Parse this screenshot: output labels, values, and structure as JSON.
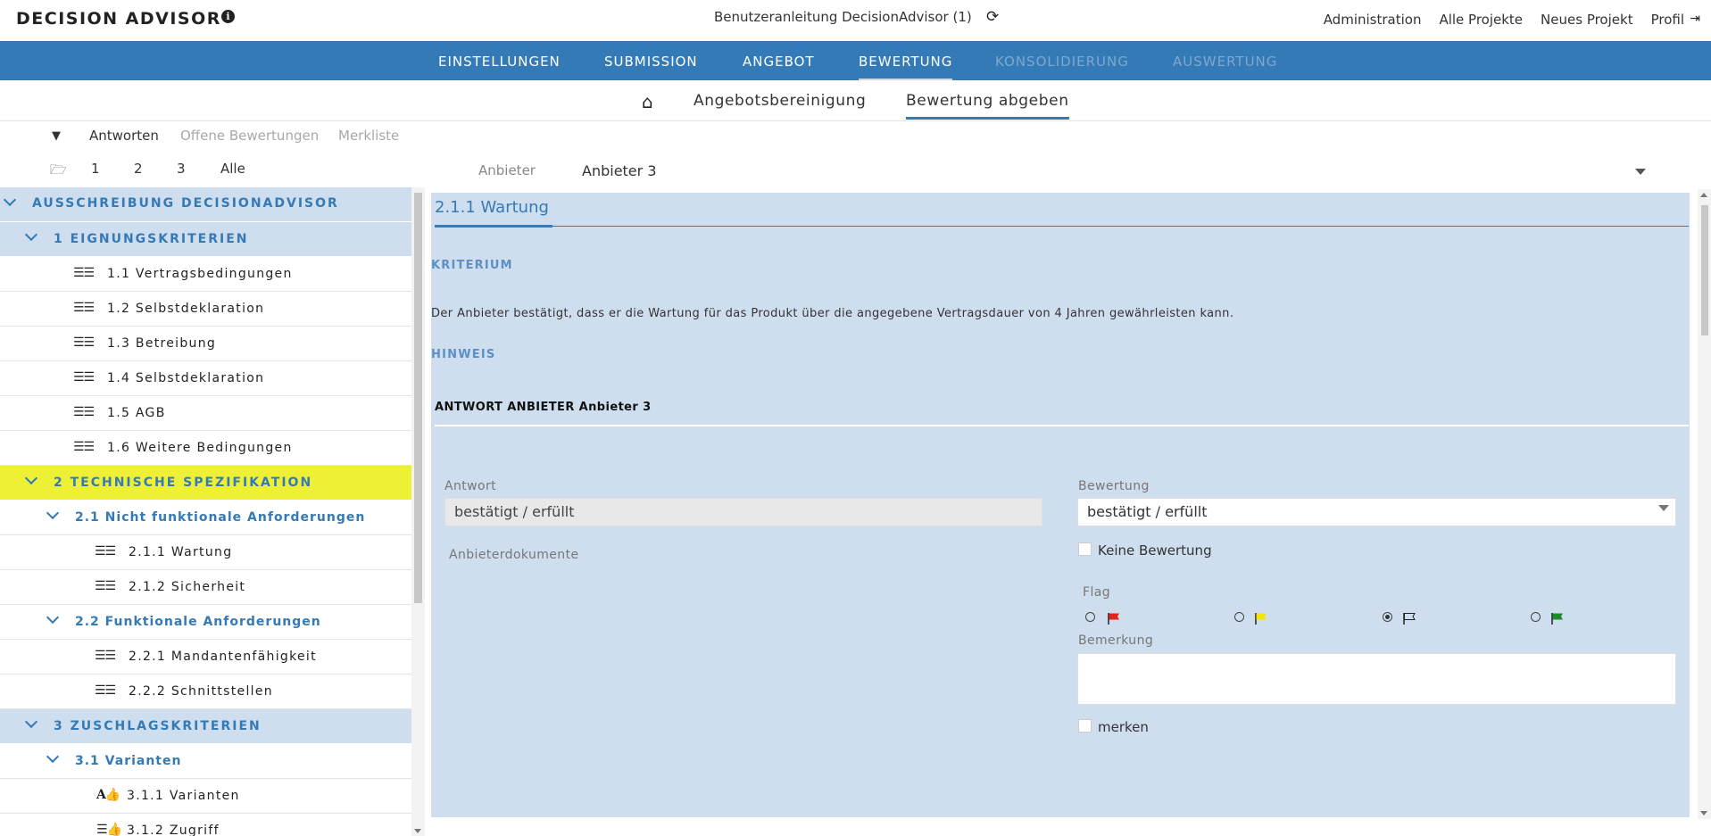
{
  "header": {
    "brand": "DECISION ADVISOR",
    "doc_title": "Benutzeranleitung DecisionAdvisor (1)",
    "nav": [
      "Administration",
      "Alle Projekte",
      "Neues Projekt",
      "Profil"
    ]
  },
  "main_nav": {
    "tabs": [
      {
        "label": "EINSTELLUNGEN",
        "state": "enabled"
      },
      {
        "label": "SUBMISSION",
        "state": "enabled"
      },
      {
        "label": "ANGEBOT",
        "state": "enabled"
      },
      {
        "label": "BEWERTUNG",
        "state": "active"
      },
      {
        "label": "KONSOLIDIERUNG",
        "state": "disabled"
      },
      {
        "label": "AUSWERTUNG",
        "state": "disabled"
      }
    ]
  },
  "sub_nav": {
    "tabs": [
      {
        "label": "Angebotsbereinigung",
        "active": false
      },
      {
        "label": "Bewertung abgeben",
        "active": true
      }
    ]
  },
  "filters": {
    "views": [
      "Antworten",
      "Offene Bewertungen",
      "Merkliste"
    ],
    "active_view": "Antworten",
    "levels": [
      "1",
      "2",
      "3",
      "Alle"
    ]
  },
  "anbieter": {
    "label": "Anbieter",
    "value": "Anbieter 3"
  },
  "tree": [
    {
      "label": "AUSSCHREIBUNG DECISIONADVISOR",
      "kind": "root"
    },
    {
      "label": "1 EIGNUNGSKRITERIEN",
      "kind": "group"
    },
    {
      "label": "1.1 Vertragsbedingungen",
      "kind": "leaf"
    },
    {
      "label": "1.2 Selbstdeklaration",
      "kind": "leaf"
    },
    {
      "label": "1.3 Betreibung",
      "kind": "leaf"
    },
    {
      "label": "1.4 Selbstdeklaration",
      "kind": "leaf"
    },
    {
      "label": "1.5 AGB",
      "kind": "leaf"
    },
    {
      "label": "1.6 Weitere Bedingungen",
      "kind": "leaf"
    },
    {
      "label": "2 TECHNISCHE SPEZIFIKATION",
      "kind": "highlight"
    },
    {
      "label": "2.1 Nicht funktionale Anforderungen",
      "kind": "sub"
    },
    {
      "label": "2.1.1 Wartung",
      "kind": "leaf2"
    },
    {
      "label": "2.1.2 Sicherheit",
      "kind": "leaf2"
    },
    {
      "label": "2.2 Funktionale Anforderungen",
      "kind": "sub"
    },
    {
      "label": "2.2.1 Mandantenfähigkeit",
      "kind": "leaf2"
    },
    {
      "label": "2.2.2 Schnittstellen",
      "kind": "leaf2"
    },
    {
      "label": "3 ZUSCHLAGSKRITERIEN",
      "kind": "group"
    },
    {
      "label": "3.1 Varianten",
      "kind": "sub"
    },
    {
      "label": "3.1.1 Varianten",
      "kind": "leaf2-a"
    },
    {
      "label": "3.1.2 Zugriff",
      "kind": "leaf2-b"
    }
  ],
  "panel": {
    "title": "2.1.1 Wartung",
    "kriterium_label": "KRITERIUM",
    "kriterium_text": "Der Anbieter bestätigt, dass er die Wartung für das Produkt über die angegebene Vertragsdauer von 4 Jahren gewährleisten kann.",
    "hinweis_label": "HINWEIS",
    "answer_heading": "ANTWORT ANBIETER Anbieter 3",
    "antwort_label": "Antwort",
    "antwort_value": "bestätigt / erfüllt",
    "dokumente_label": "Anbieterdokumente",
    "bewertung_label": "Bewertung",
    "bewertung_value": "bestätigt / erfüllt",
    "keine_bewertung_label": "Keine Bewertung",
    "flag_label": "Flag",
    "flags": [
      {
        "color": "#e0241b",
        "filled": true,
        "selected": false
      },
      {
        "color": "#f2e600",
        "filled": true,
        "selected": false
      },
      {
        "color": "#ffffff",
        "filled": false,
        "selected": true
      },
      {
        "color": "#1f8b2b",
        "filled": true,
        "selected": false
      }
    ],
    "bemerkung_label": "Bemerkung",
    "bemerkung_value": "",
    "merken_label": "merken"
  }
}
